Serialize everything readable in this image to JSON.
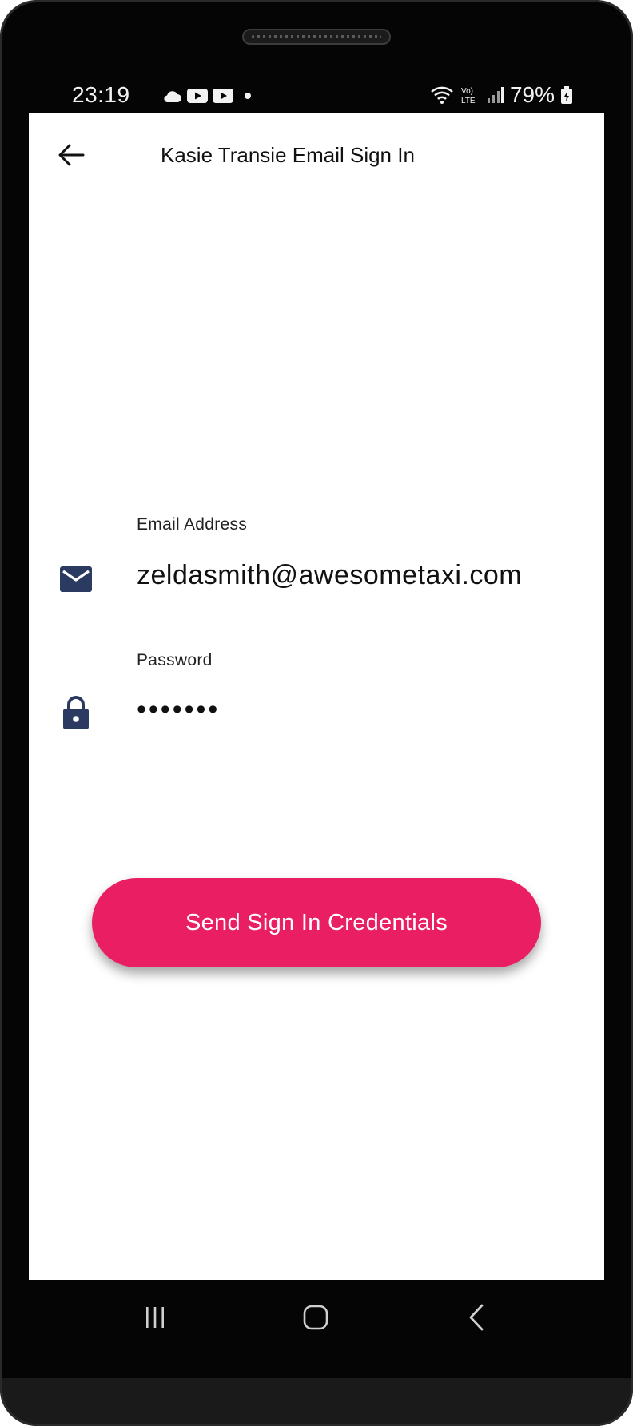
{
  "status_bar": {
    "time": "23:19",
    "left_icons": [
      "cloud-icon",
      "youtube-icon",
      "youtube-icon",
      "dot-icon"
    ],
    "right_icons": [
      "wifi-icon",
      "volte-icon",
      "signal-icon"
    ],
    "battery_percent": "79%"
  },
  "app_bar": {
    "title": "Kasie Transie Email Sign In"
  },
  "form": {
    "email_label": "Email Address",
    "email_value": "zeldasmith@awesometaxi.com",
    "password_label": "Password",
    "password_value": "•••••••"
  },
  "actions": {
    "send_label": "Send Sign In Credentials"
  },
  "colors": {
    "accent": "#e91e63",
    "icon": "#2a3a60"
  },
  "nav_bar": {
    "buttons": [
      "recents-icon",
      "home-icon",
      "back-icon"
    ]
  }
}
